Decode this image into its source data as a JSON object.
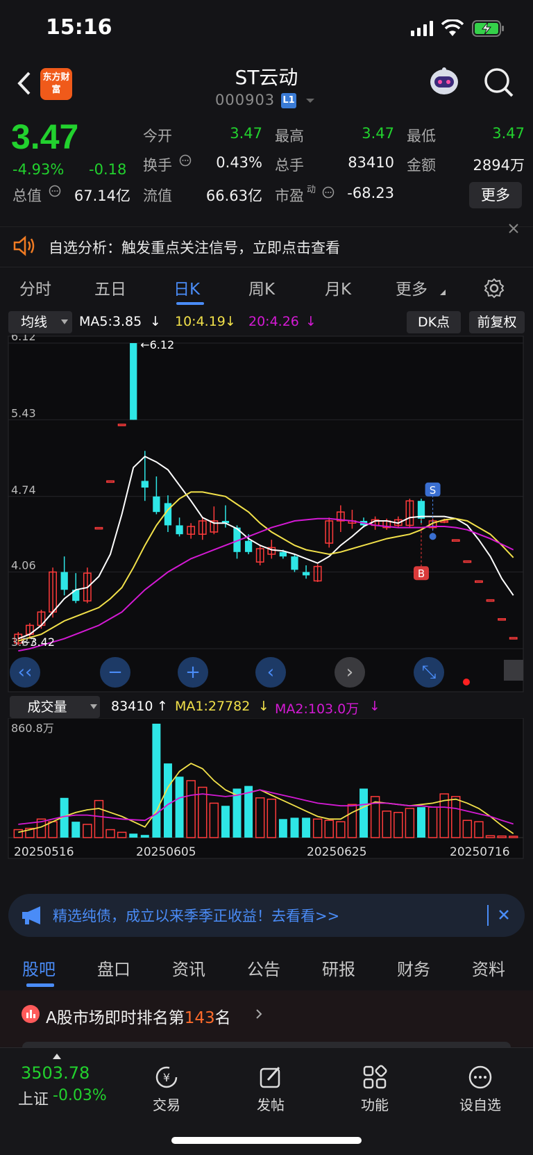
{
  "status": {
    "time": "15:16"
  },
  "header": {
    "brand": "东方财富",
    "name": "ST云动",
    "code": "000903",
    "level": "L1"
  },
  "quote": {
    "price": "3.47",
    "change_pct": "-4.93%",
    "change": "-0.18",
    "open_label": "今开",
    "open": "3.47",
    "high_label": "最高",
    "high": "3.47",
    "low_label": "最低",
    "low": "3.47",
    "turnover_label": "换手",
    "turnover": "0.43%",
    "volume_label": "总手",
    "volume": "83410",
    "amount_label": "金额",
    "amount": "2894万",
    "mktcap_label": "总值",
    "mktcap": "67.14亿",
    "float_label": "流值",
    "float": "66.63亿",
    "pe_label": "市盈",
    "pe_sup": "动",
    "pe": "-68.23",
    "more": "更多"
  },
  "notice": {
    "text": "自选分析：触发重点关注信号，立即点击查看"
  },
  "k_tabs": [
    "分时",
    "五日",
    "日K",
    "周K",
    "月K",
    "更多"
  ],
  "ma_row": {
    "selector": "均线",
    "ma5": "MA5:3.85",
    "ma10": "10:4.19",
    "ma20": "20:4.26",
    "dk": "DK点",
    "adjust": "前复权"
  },
  "colors": {
    "up": "#ff3b3b",
    "down": "#2ee6e6",
    "ma5": "#ffffff",
    "ma10": "#f2e14a",
    "ma20": "#d41ad4",
    "accent": "#4a8cf7",
    "price_green": "#22d12e"
  },
  "chart_data": {
    "type": "candlestick",
    "y_ticks": [
      "6.12",
      "5.43",
      "4.74",
      "4.06",
      "3.37"
    ],
    "ylim": [
      3.37,
      6.12
    ],
    "max_label": "6.12",
    "min_label": "3.42",
    "markers": {
      "buy": "B",
      "sell": "S"
    },
    "x_labels": [
      "20250516",
      "20250605",
      "20250625",
      "20250716"
    ],
    "candles": [
      {
        "o": 3.42,
        "h": 3.52,
        "l": 3.4,
        "c": 3.5
      },
      {
        "o": 3.5,
        "h": 3.6,
        "l": 3.46,
        "c": 3.58
      },
      {
        "o": 3.58,
        "h": 3.72,
        "l": 3.55,
        "c": 3.7
      },
      {
        "o": 3.7,
        "h": 4.1,
        "l": 3.65,
        "c": 4.06
      },
      {
        "o": 4.06,
        "h": 4.2,
        "l": 3.85,
        "c": 3.9
      },
      {
        "o": 3.9,
        "h": 4.05,
        "l": 3.78,
        "c": 3.8
      },
      {
        "o": 3.8,
        "h": 4.1,
        "l": 3.78,
        "c": 4.05
      },
      {
        "o": 4.46,
        "h": 4.46,
        "l": 4.46,
        "c": 4.46
      },
      {
        "o": 4.88,
        "h": 4.88,
        "l": 4.88,
        "c": 4.88
      },
      {
        "o": 5.39,
        "h": 5.39,
        "l": 5.39,
        "c": 5.39
      },
      {
        "o": 6.12,
        "h": 6.12,
        "l": 5.43,
        "c": 5.43
      },
      {
        "o": 4.88,
        "h": 5.15,
        "l": 4.7,
        "c": 4.82
      },
      {
        "o": 4.74,
        "h": 4.92,
        "l": 4.58,
        "c": 4.6
      },
      {
        "o": 4.68,
        "h": 4.75,
        "l": 4.42,
        "c": 4.48
      },
      {
        "o": 4.48,
        "h": 4.55,
        "l": 4.38,
        "c": 4.4
      },
      {
        "o": 4.4,
        "h": 4.5,
        "l": 4.36,
        "c": 4.47
      },
      {
        "o": 4.4,
        "h": 4.55,
        "l": 4.35,
        "c": 4.52
      },
      {
        "o": 4.42,
        "h": 4.65,
        "l": 4.4,
        "c": 4.52
      },
      {
        "o": 4.52,
        "h": 4.66,
        "l": 4.46,
        "c": 4.5
      },
      {
        "o": 4.46,
        "h": 4.48,
        "l": 4.18,
        "c": 4.24
      },
      {
        "o": 4.34,
        "h": 4.4,
        "l": 4.22,
        "c": 4.24
      },
      {
        "o": 4.15,
        "h": 4.3,
        "l": 4.12,
        "c": 4.27
      },
      {
        "o": 4.22,
        "h": 4.35,
        "l": 4.18,
        "c": 4.28
      },
      {
        "o": 4.24,
        "h": 4.26,
        "l": 4.18,
        "c": 4.2
      },
      {
        "o": 4.2,
        "h": 4.22,
        "l": 4.06,
        "c": 4.08
      },
      {
        "o": 4.06,
        "h": 4.12,
        "l": 4.0,
        "c": 4.03
      },
      {
        "o": 3.98,
        "h": 4.13,
        "l": 3.97,
        "c": 4.11
      },
      {
        "o": 4.32,
        "h": 4.55,
        "l": 4.28,
        "c": 4.52
      },
      {
        "o": 4.52,
        "h": 4.66,
        "l": 4.42,
        "c": 4.6
      },
      {
        "o": 4.5,
        "h": 4.62,
        "l": 4.45,
        "c": 4.52
      },
      {
        "o": 4.52,
        "h": 4.55,
        "l": 4.46,
        "c": 4.48
      },
      {
        "o": 4.48,
        "h": 4.56,
        "l": 4.44,
        "c": 4.53
      },
      {
        "o": 4.46,
        "h": 4.54,
        "l": 4.44,
        "c": 4.52
      },
      {
        "o": 4.48,
        "h": 4.56,
        "l": 4.46,
        "c": 4.53
      },
      {
        "o": 4.48,
        "h": 4.72,
        "l": 4.46,
        "c": 4.7
      },
      {
        "o": 4.7,
        "h": 4.72,
        "l": 4.5,
        "c": 4.54
      },
      {
        "o": 4.46,
        "h": 4.54,
        "l": 4.44,
        "c": 4.52
      },
      {
        "o": 4.52,
        "h": 4.54,
        "l": 4.5,
        "c": 4.52
      },
      {
        "o": 4.35,
        "h": 4.35,
        "l": 4.35,
        "c": 4.35
      },
      {
        "o": 4.16,
        "h": 4.16,
        "l": 4.16,
        "c": 4.16
      },
      {
        "o": 3.98,
        "h": 3.98,
        "l": 3.98,
        "c": 3.98
      },
      {
        "o": 3.81,
        "h": 3.81,
        "l": 3.81,
        "c": 3.81
      },
      {
        "o": 3.64,
        "h": 3.64,
        "l": 3.64,
        "c": 3.64
      },
      {
        "o": 3.47,
        "h": 3.47,
        "l": 3.47,
        "c": 3.47
      }
    ],
    "ma5": [
      3.46,
      3.5,
      3.58,
      3.7,
      3.82,
      3.9,
      3.92,
      4.02,
      4.22,
      4.58,
      5.0,
      5.1,
      5.05,
      4.98,
      4.84,
      4.7,
      4.55,
      4.5,
      4.5,
      4.45,
      4.36,
      4.3,
      4.26,
      4.25,
      4.22,
      4.18,
      4.14,
      4.2,
      4.3,
      4.38,
      4.47,
      4.52,
      4.52,
      4.5,
      4.55,
      4.56,
      4.56,
      4.56,
      4.54,
      4.48,
      4.35,
      4.2,
      4.0,
      3.85
    ],
    "ma10": [
      3.44,
      3.47,
      3.5,
      3.56,
      3.62,
      3.66,
      3.7,
      3.74,
      3.82,
      3.92,
      4.1,
      4.3,
      4.48,
      4.62,
      4.72,
      4.78,
      4.78,
      4.76,
      4.74,
      4.67,
      4.6,
      4.5,
      4.42,
      4.36,
      4.3,
      4.26,
      4.24,
      4.22,
      4.24,
      4.27,
      4.3,
      4.33,
      4.36,
      4.38,
      4.4,
      4.44,
      4.5,
      4.53,
      4.54,
      4.52,
      4.46,
      4.4,
      4.3,
      4.19
    ],
    "ma20": [
      3.35,
      3.37,
      3.4,
      3.43,
      3.46,
      3.5,
      3.54,
      3.58,
      3.64,
      3.7,
      3.8,
      3.9,
      3.98,
      4.06,
      4.12,
      4.18,
      4.22,
      4.26,
      4.3,
      4.34,
      4.38,
      4.42,
      4.46,
      4.49,
      4.52,
      4.53,
      4.54,
      4.54,
      4.53,
      4.52,
      4.5,
      4.48,
      4.47,
      4.46,
      4.46,
      4.46,
      4.47,
      4.47,
      4.46,
      4.44,
      4.4,
      4.36,
      4.31,
      4.26
    ]
  },
  "volume": {
    "selector": "成交量",
    "vol": "83410",
    "ma1": "MA1:27782",
    "ma2": "MA2:103.0万",
    "max_tick": "860.8万",
    "bars": [
      60,
      70,
      140,
      120,
      300,
      120,
      100,
      280,
      60,
      40,
      30,
      20,
      860,
      560,
      460,
      430,
      380,
      260,
      240,
      370,
      390,
      300,
      290,
      140,
      150,
      150,
      140,
      130,
      120,
      250,
      370,
      310,
      200,
      190,
      220,
      230,
      230,
      330,
      310,
      130,
      120,
      14,
      12,
      10
    ],
    "ma1_line": [
      40,
      60,
      80,
      120,
      160,
      190,
      210,
      220,
      190,
      160,
      120,
      80,
      200,
      380,
      500,
      560,
      520,
      430,
      360,
      320,
      340,
      360,
      320,
      280,
      240,
      200,
      160,
      140,
      140,
      190,
      230,
      270,
      260,
      250,
      240,
      250,
      260,
      280,
      290,
      260,
      220,
      160,
      90,
      30
    ],
    "ma2_line": [
      100,
      110,
      120,
      140,
      160,
      170,
      170,
      160,
      150,
      140,
      135,
      130,
      180,
      250,
      300,
      320,
      330,
      320,
      310,
      320,
      340,
      360,
      340,
      320,
      300,
      280,
      260,
      250,
      240,
      240,
      250,
      260,
      260,
      250,
      240,
      240,
      230,
      230,
      220,
      200,
      180,
      160,
      130,
      103
    ]
  },
  "ad": {
    "text": "精选纯债，成立以来季季正收益！去看看>>"
  },
  "info_tabs": [
    "股吧",
    "盘口",
    "资讯",
    "公告",
    "研报",
    "财务",
    "资料"
  ],
  "rank": {
    "prefix": "A股市场即时排名第",
    "num": "143",
    "suffix": "名"
  },
  "bottom_bar": {
    "index_value": "3503.78",
    "index_name": "上证",
    "index_change": "-0.03%",
    "items": [
      "交易",
      "发帖",
      "功能",
      "设自选"
    ]
  }
}
